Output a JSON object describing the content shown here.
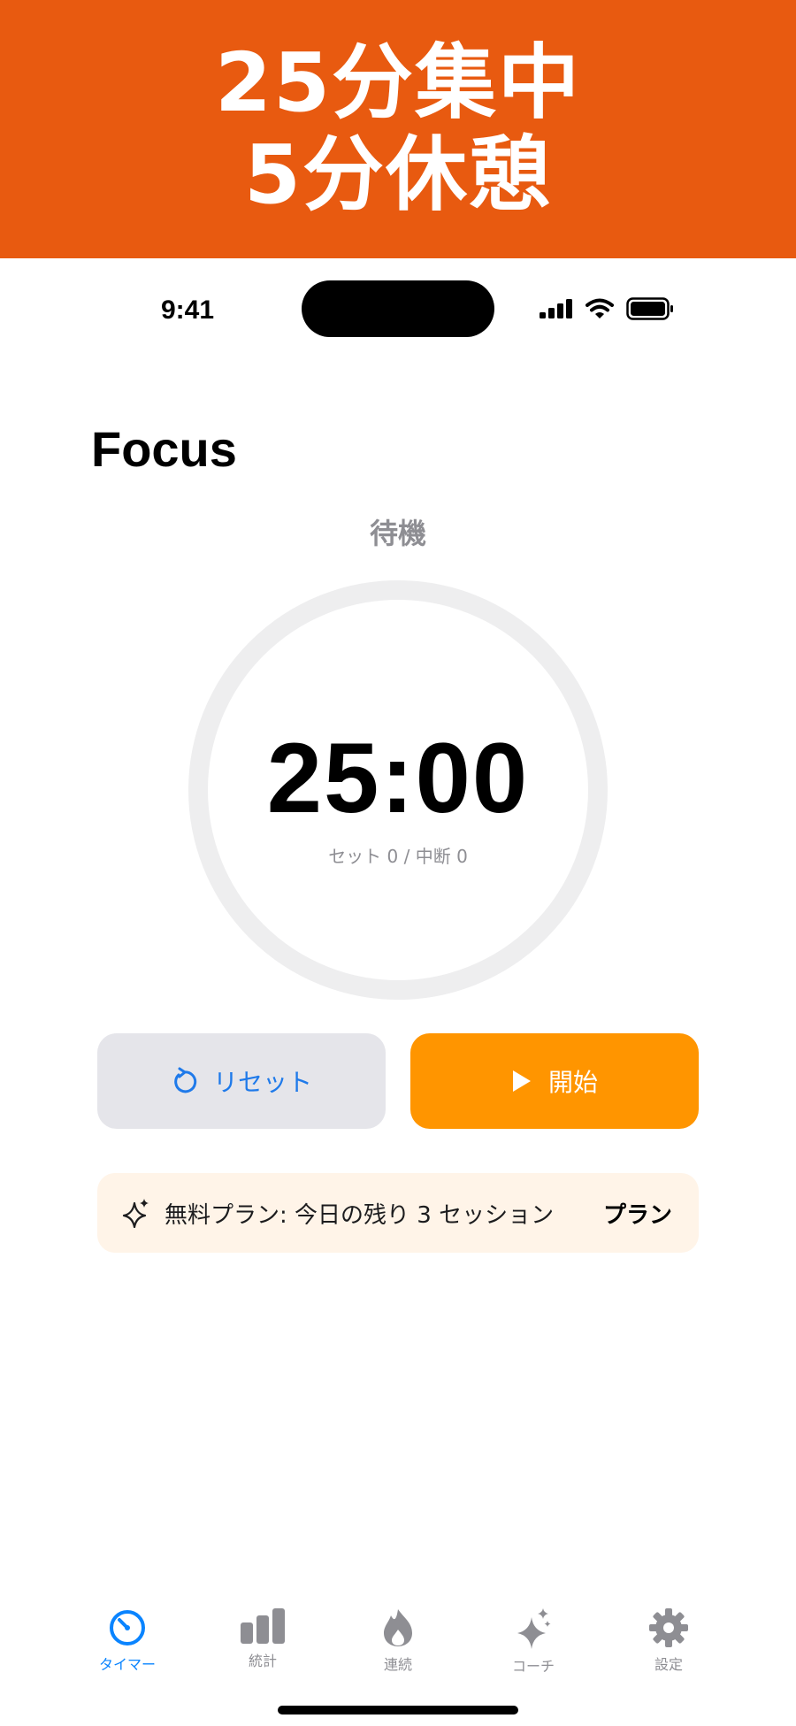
{
  "banner": {
    "line1": "25分集中",
    "line2": "5分休憩"
  },
  "status_bar": {
    "time": "9:41"
  },
  "screen": {
    "title": "Focus",
    "state_label": "待機",
    "timer": "25:00",
    "counts": "セット 0 / 中断 0"
  },
  "buttons": {
    "reset_label": "リセット",
    "start_label": "開始"
  },
  "plan": {
    "text": "無料プラン: 今日の残り 3 セッション",
    "link": "プラン"
  },
  "tabs": [
    {
      "label": "タイマー",
      "icon": "timer-icon",
      "active": true
    },
    {
      "label": "統計",
      "icon": "bar-chart-icon",
      "active": false
    },
    {
      "label": "連続",
      "icon": "flame-icon",
      "active": false
    },
    {
      "label": "コーチ",
      "icon": "sparkles-icon",
      "active": false
    },
    {
      "label": "設定",
      "icon": "gear-icon",
      "active": false
    }
  ],
  "colors": {
    "banner": "#E85A10",
    "accent": "#FF9500",
    "link_blue": "#1F7AEA",
    "tab_active": "#0A84FF",
    "tab_inactive": "#8E8E93"
  }
}
